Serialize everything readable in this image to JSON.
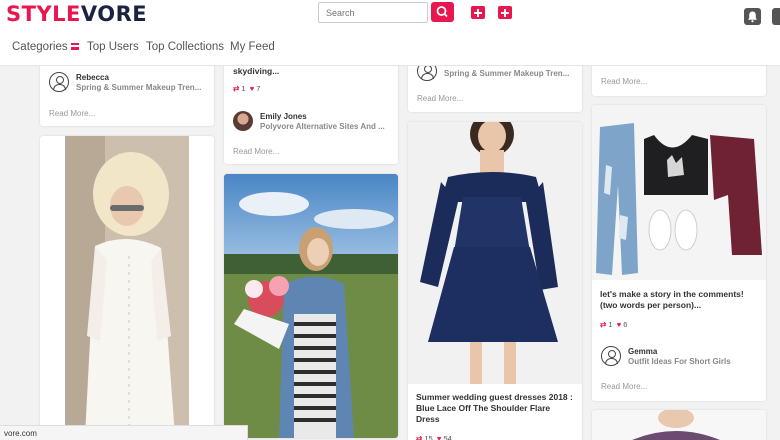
{
  "header": {
    "logo_a": "STYLE",
    "logo_b": "VORE",
    "search_placeholder": "Search"
  },
  "nav": {
    "categories": "Categories",
    "top_users": "Top Users",
    "top_collections": "Top Collections",
    "my_feed": "My Feed"
  },
  "cards": {
    "c1_top": {
      "user": "Rebecca",
      "collection": "Spring & Summer Makeup Tren...",
      "read_more": "Read More..."
    },
    "c2_top": {
      "title": "skydiving...",
      "repins": "1",
      "likes": "7",
      "user": "Emily Jones",
      "collection": "Polyvore Alternative Sites And ...",
      "read_more": "Read More..."
    },
    "c3_top": {
      "collection": "Spring & Summer Makeup Tren...",
      "read_more": "Read More..."
    },
    "c4_top": {
      "read_more": "Read More..."
    },
    "c3_dress": {
      "title": "Summer wedding guest dresses 2018 : Blue Lace Off The Shoulder Flare Dress",
      "repins": "15",
      "likes": "54"
    },
    "c4_outfit": {
      "title": "let's make a story in the comments! (two words per person)...",
      "repins": "1",
      "likes": "6",
      "user": "Gemma",
      "collection": "Outfit Ideas For Short Girls",
      "read_more": "Read More..."
    }
  },
  "status_url": "vore.com",
  "colors": {
    "brand": "#e8174f",
    "logo_dark": "#1c2340"
  }
}
